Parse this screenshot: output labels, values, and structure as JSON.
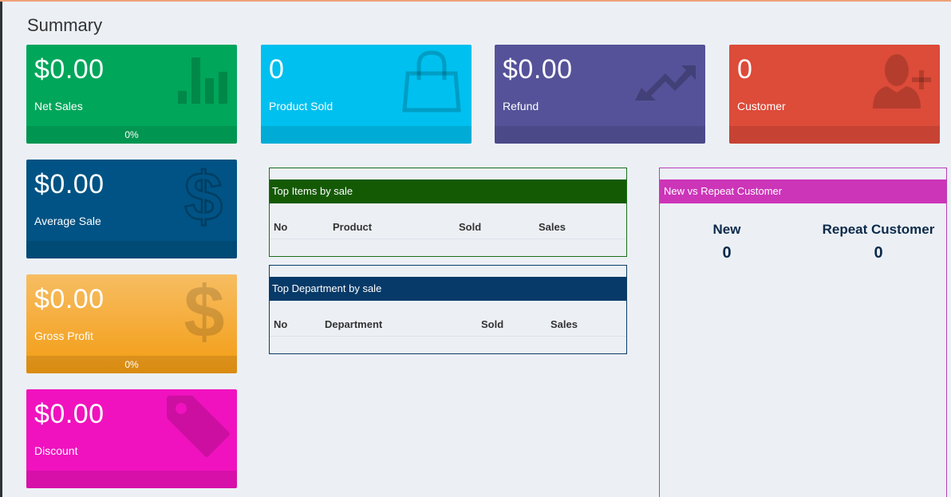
{
  "page": {
    "title": "Summary"
  },
  "stats": {
    "net_sales": {
      "value": "$0.00",
      "label": "Net Sales",
      "footer": "0%",
      "icon": "bar-chart-icon"
    },
    "product_sold": {
      "value": "0",
      "label": "Product Sold",
      "footer": "",
      "icon": "shopping-bag-icon"
    },
    "refund": {
      "value": "$0.00",
      "label": "Refund",
      "footer": "",
      "icon": "trend-down-icon"
    },
    "customer": {
      "value": "0",
      "label": "Customer",
      "footer": "",
      "icon": "user-add-icon"
    },
    "average_sale": {
      "value": "$0.00",
      "label": "Average Sale",
      "footer": "",
      "icon": "dollar-icon"
    },
    "gross_profit": {
      "value": "$0.00",
      "label": "Gross Profit",
      "footer": "0%",
      "icon": "dollar-icon"
    },
    "discount": {
      "value": "$0.00",
      "label": "Discount",
      "footer": "",
      "icon": "tag-icon"
    }
  },
  "top_items": {
    "title": "Top Items by sale",
    "columns": [
      "No",
      "Product",
      "Sold",
      "Sales"
    ]
  },
  "top_department": {
    "title": "Top Department by sale",
    "columns": [
      "No",
      "Department",
      "Sold",
      "Sales"
    ]
  },
  "customers": {
    "title": "New vs Repeat Customer",
    "new_label": "New",
    "new_value": "0",
    "repeat_label": "Repeat Customer",
    "repeat_value": "0"
  },
  "colors": {
    "green": "#00a65a",
    "aqua": "#00c0ef",
    "purple": "#555299",
    "red": "#dd4b39",
    "blue": "#005384",
    "orange": "#f39c12",
    "pink": "#f012be"
  }
}
